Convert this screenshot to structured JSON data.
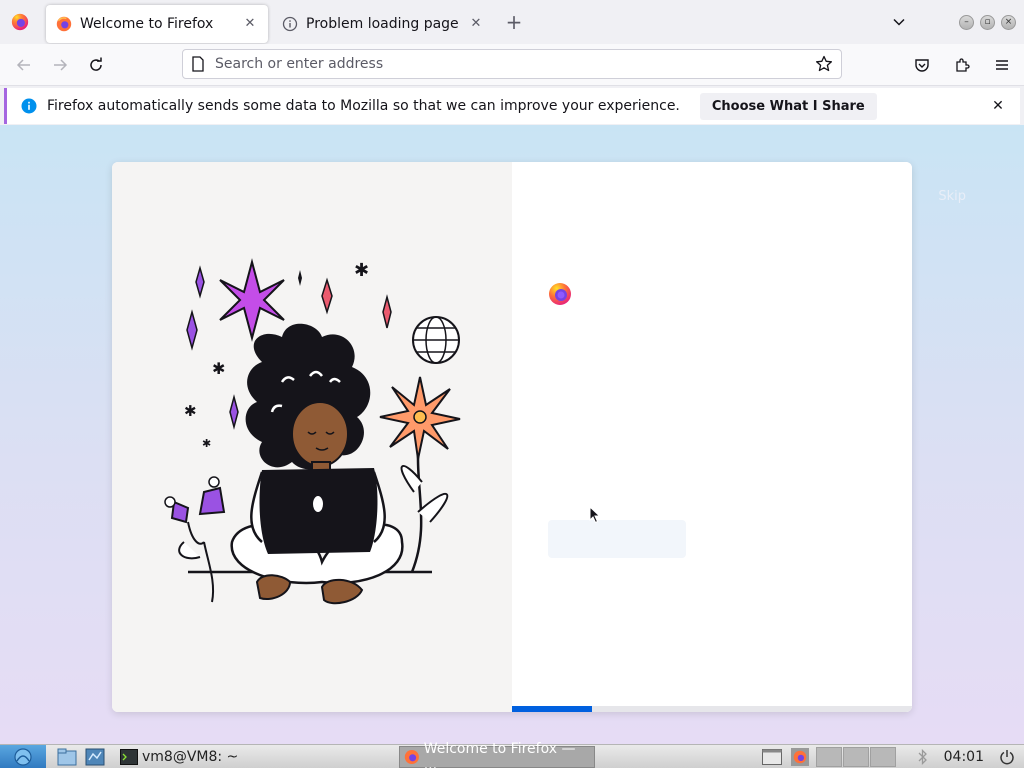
{
  "browser": {
    "tabs": [
      {
        "title": "Welcome to Firefox",
        "active": true,
        "icon": "firefox-icon"
      },
      {
        "title": "Problem loading page",
        "active": false,
        "icon": "info-icon"
      }
    ],
    "close_glyph": "✕",
    "new_tab_glyph": "+",
    "window_controls": {
      "minimize": "–",
      "maximize": "▫",
      "close": "×"
    }
  },
  "navbar": {
    "url_placeholder": "Search or enter address",
    "icons": [
      "back-icon",
      "forward-icon",
      "reload-icon",
      "page-icon",
      "bookmark-star-icon",
      "pocket-icon",
      "extensions-icon",
      "menu-icon"
    ]
  },
  "notification": {
    "message": "Firefox automatically sends some data to Mozilla so that we can improve your experience.",
    "button": "Choose What I Share"
  },
  "onboarding": {
    "skip_label": "Skip",
    "heading": "",
    "primary_button": "",
    "progress_fraction": 0.2
  },
  "taskbar": {
    "terminal_task": "vm8@VM8: ~",
    "firefox_task": "Welcome to Firefox — ...",
    "clock": "04:01"
  },
  "colors": {
    "accent": "#0060df",
    "notification_accent": "#a566e0"
  }
}
